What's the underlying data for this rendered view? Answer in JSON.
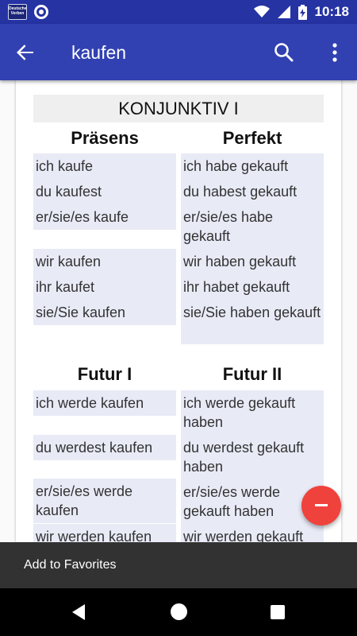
{
  "status_bar": {
    "app_logo_text": "Deutsche Verben",
    "time": "10:18",
    "icons": [
      "app-logo-icon",
      "ring-icon",
      "wifi-icon",
      "signal-icon",
      "battery-charging-icon"
    ]
  },
  "app_bar": {
    "title": "kaufen",
    "back_icon": "arrow-left-icon",
    "search_icon": "search-icon",
    "more_icon": "more-vert-icon"
  },
  "section": {
    "title": "KONJUNKTIV I",
    "left_heading": "Präsens",
    "right_heading": "Perfekt",
    "left_heading_2": "Futur I",
    "right_heading_2": "Futur II",
    "praesens": [
      "ich kaufe",
      "du kaufest",
      "er/sie/es kaufe",
      "wir kaufen",
      "ihr kaufet",
      "sie/Sie kaufen"
    ],
    "perfekt": [
      "ich habe gekauft",
      "du habest gekauft",
      "er/sie/es habe gekauft",
      "wir haben gekauft",
      "ihr habet gekauft",
      "sie/Sie haben gekauft"
    ],
    "futur1": [
      "ich werde kaufen",
      "du werdest kaufen",
      "er/sie/es werde kaufen",
      "wir werden kaufen"
    ],
    "futur2": [
      "ich werde gekauft haben",
      "du werdest gekauft haben",
      "er/sie/es werde gekauft haben",
      "wir werden gekauft"
    ]
  },
  "fab_icon": "remove-icon",
  "snackbar": {
    "text": "Add to Favorites"
  },
  "nav_bar": {
    "icons": [
      "nav-back-icon",
      "nav-home-icon",
      "nav-recents-icon"
    ]
  },
  "colors": {
    "status_bar": "#2533a3",
    "app_bar": "#3141b2",
    "cell_bg": "#e8eaf6",
    "fab": "#f0423c",
    "snackbar": "#323232"
  }
}
